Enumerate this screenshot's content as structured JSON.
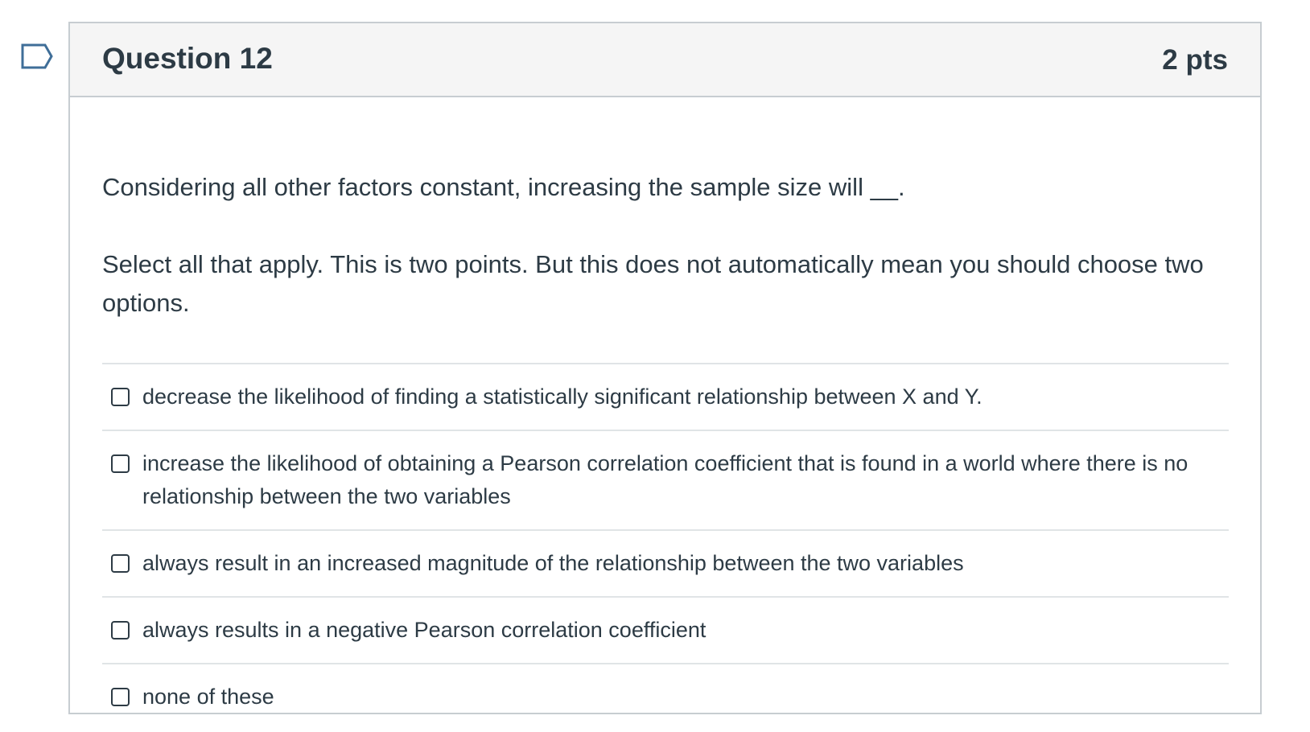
{
  "question": {
    "title": "Question 12",
    "points": "2 pts",
    "flag_icon": "bookmark-flag-icon",
    "text": "Considering all other factors constant, increasing the sample size will __.",
    "instructions": "Select all that apply. This is two points. But this does not automatically mean you should choose two options.",
    "answers": [
      {
        "label": "decrease the likelihood of finding a statistically significant relationship between X and Y.",
        "checked": false
      },
      {
        "label": "increase the likelihood of obtaining a Pearson correlation coefficient that is found in a world where there is no relationship between the two variables",
        "checked": false
      },
      {
        "label": "always result in an increased magnitude of the relationship between the two variables",
        "checked": false
      },
      {
        "label": "always results in a negative Pearson correlation coefficient",
        "checked": false
      },
      {
        "label": "none of these",
        "checked": false
      }
    ]
  },
  "colors": {
    "text": "#2d3b45",
    "header_bg": "#f5f5f5",
    "border": "#c7cdd1",
    "flag": "#3f6e98"
  }
}
